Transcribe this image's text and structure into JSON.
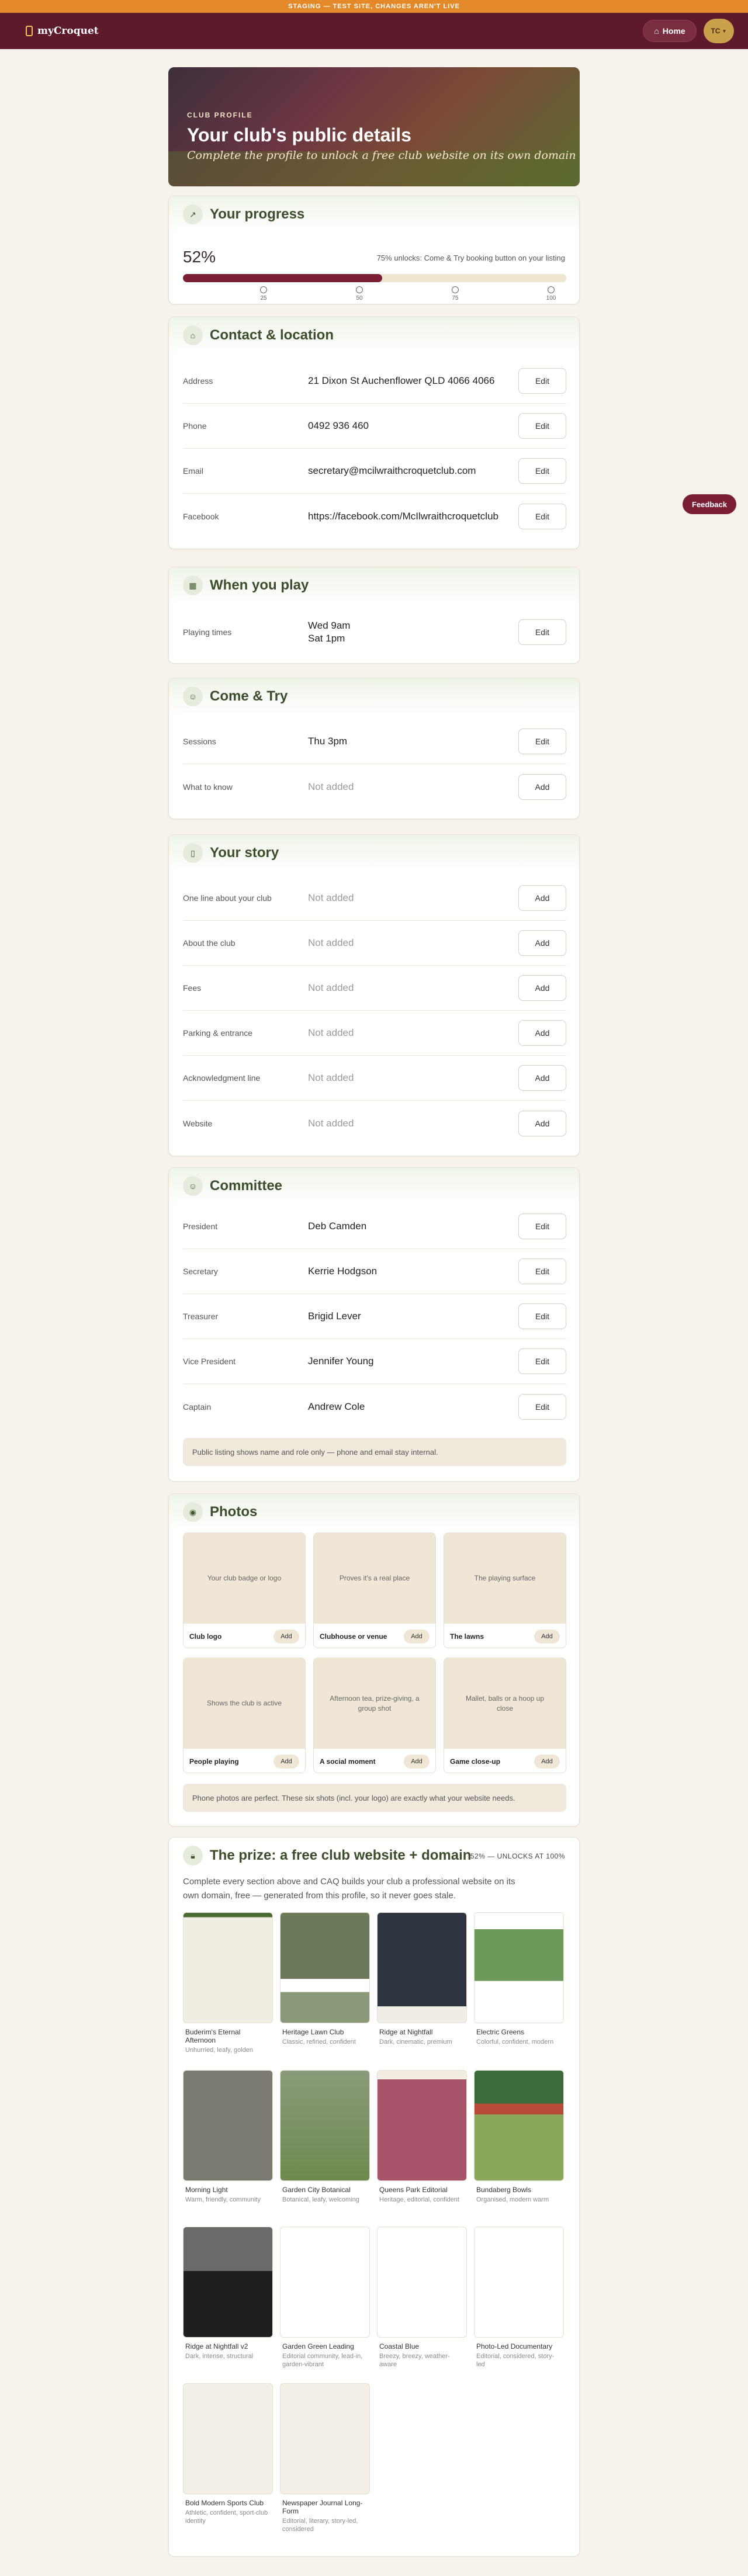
{
  "staging_banner": "STAGING — TEST SITE, CHANGES AREN'T LIVE",
  "brand": "myCroquet",
  "nav": {
    "home": "Home",
    "user_initials": "TC"
  },
  "hero": {
    "kicker": "CLUB PROFILE",
    "title": "Your club's public details",
    "subtitle": "Complete the profile to unlock a free club website on its own domain"
  },
  "progress": {
    "title": "Your progress",
    "percent_label": "52%",
    "percent_value": 52,
    "note": "75% unlocks: Come & Try booking button on your listing",
    "milestones": [
      "25",
      "50",
      "75",
      "100"
    ]
  },
  "contact": {
    "title": "Contact & location",
    "rows": [
      {
        "label": "Address",
        "value": "21 Dixon St Auchenflower QLD 4066 4066",
        "action": "Edit"
      },
      {
        "label": "Phone",
        "value": "0492 936 460",
        "action": "Edit"
      },
      {
        "label": "Email",
        "value": "secretary@mcilwraithcroquetclub.com",
        "action": "Edit"
      },
      {
        "label": "Facebook",
        "value": "https://facebook.com/McIlwraithcroquetclub",
        "action": "Edit"
      }
    ]
  },
  "when": {
    "title": "When you play",
    "rows": [
      {
        "label": "Playing times",
        "value": "Wed 9am\nSat 1pm",
        "action": "Edit"
      }
    ]
  },
  "come_try": {
    "title": "Come & Try",
    "rows": [
      {
        "label": "Sessions",
        "value": "Thu 3pm",
        "action": "Edit"
      },
      {
        "label": "What to know",
        "value": "Not added",
        "action": "Add"
      }
    ]
  },
  "story": {
    "title": "Your story",
    "rows": [
      {
        "label": "One line about your club",
        "value": "Not added",
        "action": "Add"
      },
      {
        "label": "About the club",
        "value": "Not added",
        "action": "Add"
      },
      {
        "label": "Fees",
        "value": "Not added",
        "action": "Add"
      },
      {
        "label": "Parking & entrance",
        "value": "Not added",
        "action": "Add"
      },
      {
        "label": "Acknowledgment line",
        "value": "Not added",
        "action": "Add"
      },
      {
        "label": "Website",
        "value": "Not added",
        "action": "Add"
      }
    ]
  },
  "committee": {
    "title": "Committee",
    "rows": [
      {
        "label": "President",
        "value": "Deb Camden",
        "action": "Edit"
      },
      {
        "label": "Secretary",
        "value": "Kerrie Hodgson",
        "action": "Edit"
      },
      {
        "label": "Treasurer",
        "value": "Brigid Lever",
        "action": "Edit"
      },
      {
        "label": "Vice President",
        "value": "Jennifer Young",
        "action": "Edit"
      },
      {
        "label": "Captain",
        "value": "Andrew Cole",
        "action": "Edit"
      }
    ],
    "notice": "Public listing shows name and role only — phone and email stay internal."
  },
  "photos": {
    "title": "Photos",
    "items": [
      {
        "name": "Club logo",
        "hint": "Your club badge or logo",
        "action": "Add"
      },
      {
        "name": "Clubhouse or venue",
        "hint": "Proves it's a real place",
        "action": "Add"
      },
      {
        "name": "The lawns",
        "hint": "The playing surface",
        "action": "Add"
      },
      {
        "name": "People playing",
        "hint": "Shows the club is active",
        "action": "Add"
      },
      {
        "name": "A social moment",
        "hint": "Afternoon tea, prize-giving, a group shot",
        "action": "Add"
      },
      {
        "name": "Game close-up",
        "hint": "Mallet, balls or a hoop up close",
        "action": "Add"
      }
    ],
    "notice": "Phone photos are perfect. These six shots (incl. your logo) are exactly what your website needs."
  },
  "prize": {
    "title": "The prize: a free club website + domain",
    "badge": "52% — UNLOCKS AT 100%",
    "description": "Complete every section above and CAQ builds your club a professional website on its own domain, free — generated from this profile, so it never goes stale.",
    "themes": [
      {
        "name": "Buderim's Eternal Afternoon",
        "desc": "Unhurried, leafy, golden"
      },
      {
        "name": "Heritage Lawn Club",
        "desc": "Classic, refined, confident"
      },
      {
        "name": "Ridge at Nightfall",
        "desc": "Dark, cinematic, premium"
      },
      {
        "name": "Electric Greens",
        "desc": "Colorful, confident, modern"
      },
      {
        "name": "Morning Light",
        "desc": "Warm, friendly, community"
      },
      {
        "name": "Garden City Botanical",
        "desc": "Botanical, leafy, welcoming"
      },
      {
        "name": "Queens Park Editorial",
        "desc": "Heritage, editorial, confident"
      },
      {
        "name": "Bundaberg Bowls",
        "desc": "Organised, modern warm"
      },
      {
        "name": "Ridge at Nightfall v2",
        "desc": "Dark, intense, structural"
      },
      {
        "name": "Garden Green Leading",
        "desc": "Editorial community, lead-in, garden-vibrant"
      },
      {
        "name": "Coastal Blue",
        "desc": "Breezy, breezy, weather-aware"
      },
      {
        "name": "Photo-Led Documentary",
        "desc": "Editorial, considered, story-led"
      },
      {
        "name": "Bold Modern Sports Club",
        "desc": "Athletic, confident, sport-club identity"
      },
      {
        "name": "Newspaper Journal Long-Form",
        "desc": "Editorial, literary, story-led, considered"
      }
    ]
  },
  "feedback": "Feedback",
  "colors": {
    "brand": "#5c1a2b",
    "accent": "#7a1f33",
    "staging": "#e3892a",
    "green": "#3b4d2a"
  }
}
